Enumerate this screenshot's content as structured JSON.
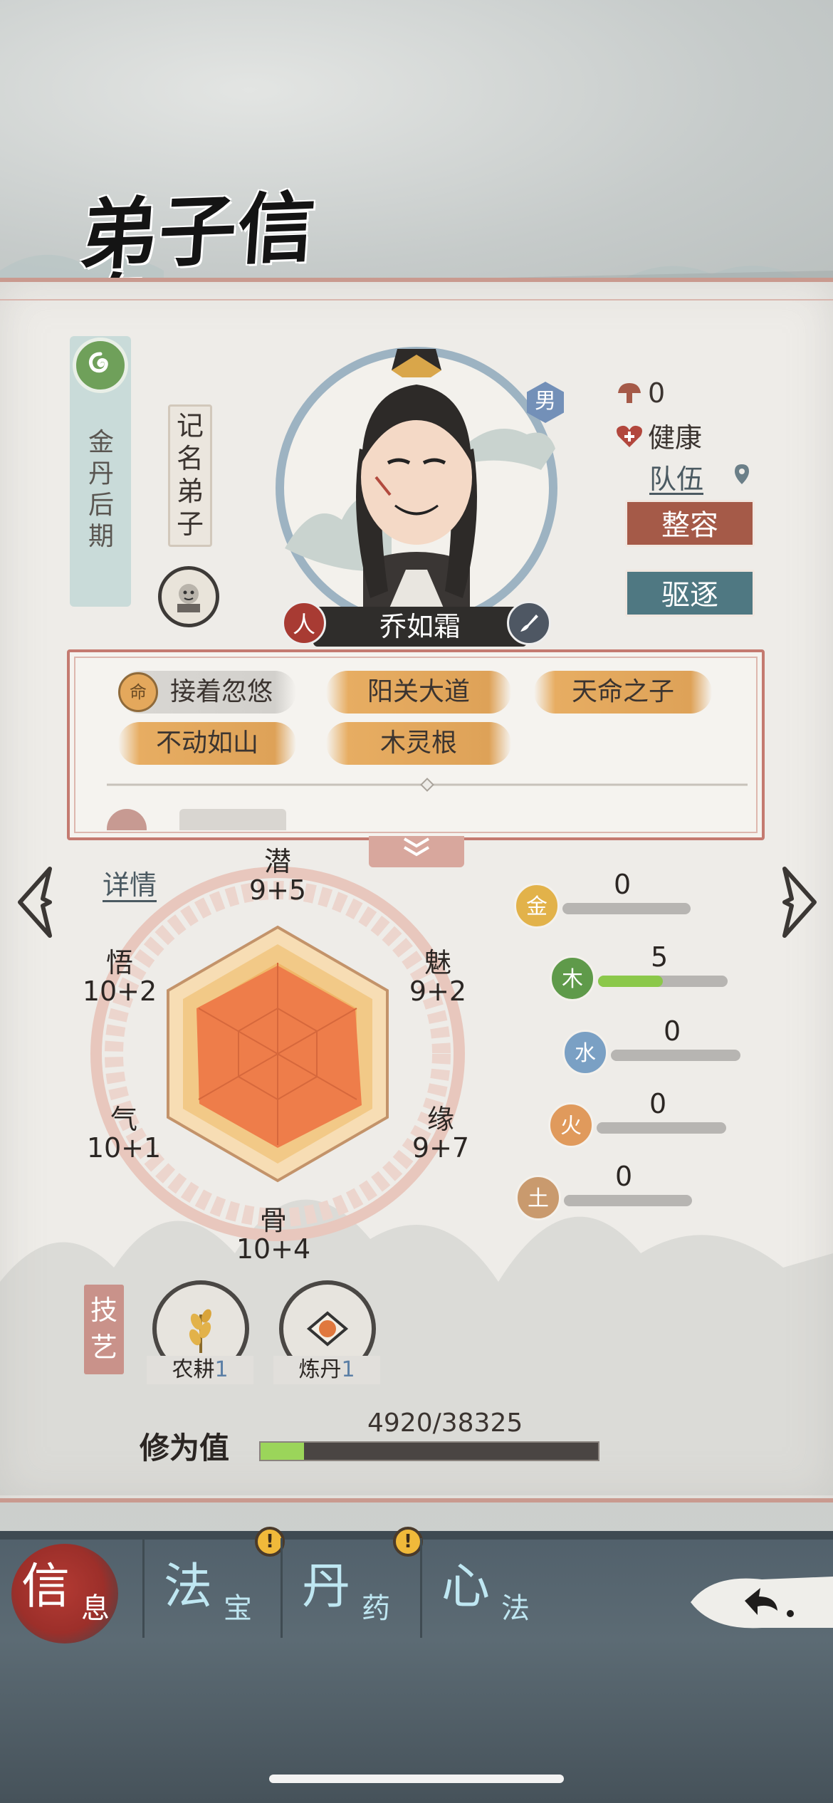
{
  "header": {
    "title": "弟子信息"
  },
  "disciple": {
    "realm": "金丹后期",
    "rank": "记名弟子",
    "gender": "男",
    "race_icon": "人",
    "name": "乔如霜",
    "stats": {
      "count": "0",
      "health": "健康",
      "team_link": "队伍"
    },
    "actions": {
      "makeover": "整容",
      "expel": "驱逐"
    }
  },
  "traits": {
    "icon_label": "命",
    "items": [
      "接着忽悠",
      "阳关大道",
      "天命之子",
      "不动如山",
      "木灵根"
    ]
  },
  "details_link": "详情",
  "attributes": {
    "potential": {
      "name": "潜",
      "value": "9+5"
    },
    "charm": {
      "name": "魅",
      "value": "9+2"
    },
    "fate": {
      "name": "缘",
      "value": "9+7"
    },
    "bone": {
      "name": "骨",
      "value": "10+4"
    },
    "qi": {
      "name": "气",
      "value": "10+1"
    },
    "insight": {
      "name": "悟",
      "value": "10+2"
    }
  },
  "elements": [
    {
      "name": "金",
      "value": "0",
      "level": 0,
      "color": "#e2b24a"
    },
    {
      "name": "木",
      "value": "5",
      "level": 0.5,
      "color": "#5f9a4a"
    },
    {
      "name": "水",
      "value": "0",
      "level": 0,
      "color": "#7aa0c4"
    },
    {
      "name": "火",
      "value": "0",
      "level": 0,
      "color": "#e09a5c"
    },
    {
      "name": "土",
      "value": "0",
      "level": 0,
      "color": "#c99a6e"
    }
  ],
  "skills": {
    "label": "技艺",
    "items": [
      {
        "name": "农耕",
        "level": "1"
      },
      {
        "name": "炼丹",
        "level": "1"
      }
    ]
  },
  "cultivation": {
    "label": "修为值",
    "current": 4920,
    "max": 38325,
    "text": "4920/38325"
  },
  "nav": {
    "tabs": [
      {
        "main": "信",
        "sub": "息",
        "active": true,
        "alert": false
      },
      {
        "main": "法",
        "sub": "宝",
        "active": false,
        "alert": true
      },
      {
        "main": "丹",
        "sub": "药",
        "active": false,
        "alert": true
      },
      {
        "main": "心",
        "sub": "法",
        "active": false,
        "alert": false
      }
    ],
    "alert_symbol": "!"
  }
}
